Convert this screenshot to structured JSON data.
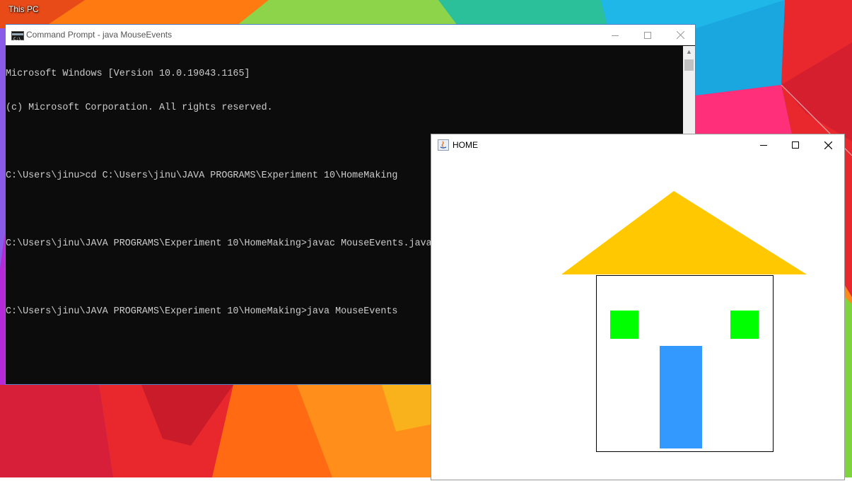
{
  "desktop": {
    "icon_label": "This PC"
  },
  "cmd_window": {
    "title": "Command Prompt - java  MouseEvents",
    "lines": [
      "Microsoft Windows [Version 10.0.19043.1165]",
      "(c) Microsoft Corporation. All rights reserved.",
      "",
      "C:\\Users\\jinu>cd C:\\Users\\jinu\\JAVA PROGRAMS\\Experiment 10\\HomeMaking",
      "",
      "C:\\Users\\jinu\\JAVA PROGRAMS\\Experiment 10\\HomeMaking>javac MouseEvents.java",
      "",
      "C:\\Users\\jinu\\JAVA PROGRAMS\\Experiment 10\\HomeMaking>java MouseEvents"
    ]
  },
  "home_window": {
    "title": "HOME",
    "drawing": {
      "roof_color": "#ffc800",
      "wall_border_color": "#000000",
      "window_color": "#00ff00",
      "door_color": "#3399ff"
    }
  },
  "icons": {
    "cmd": "cmd-icon",
    "java": "java-icon",
    "minimize": "minimize-icon",
    "maximize": "maximize-icon",
    "close": "close-icon"
  }
}
